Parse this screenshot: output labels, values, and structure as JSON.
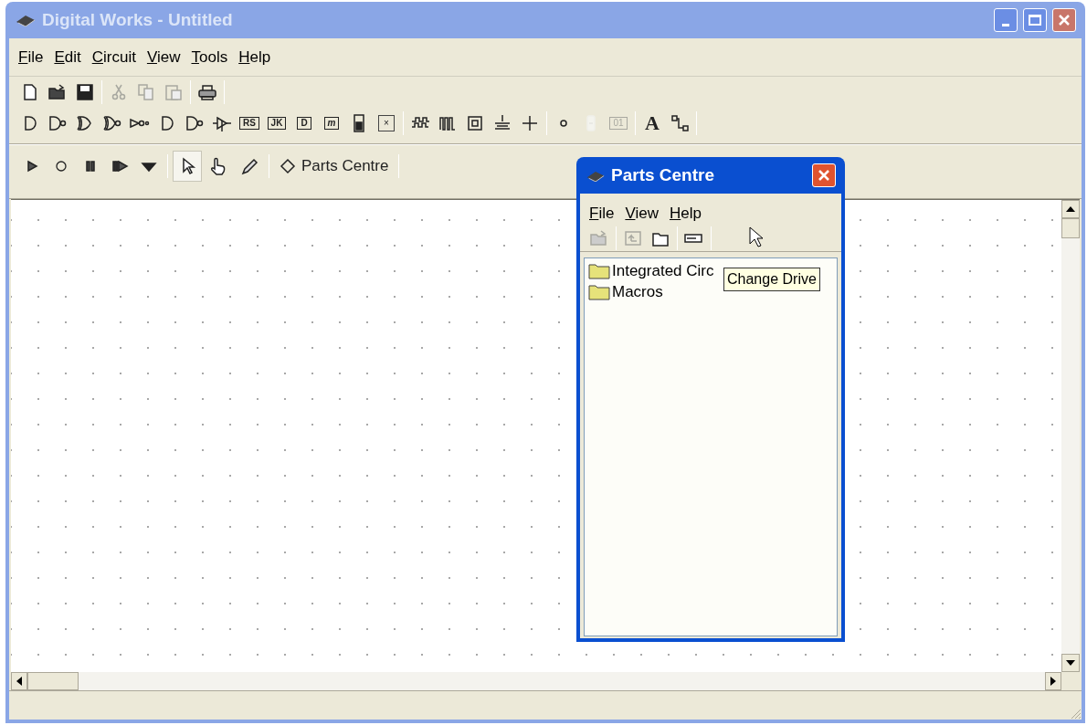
{
  "window": {
    "title": "Digital Works - Untitled",
    "active": false
  },
  "menu": [
    {
      "label": "File"
    },
    {
      "label": "Edit"
    },
    {
      "label": "Circuit"
    },
    {
      "label": "View"
    },
    {
      "label": "Tools"
    },
    {
      "label": "Help"
    }
  ],
  "toolbar_rows": [
    [
      [
        {
          "kind": "new",
          "disabled": false
        },
        {
          "kind": "open",
          "disabled": false
        },
        {
          "kind": "save",
          "disabled": false
        }
      ],
      [
        {
          "kind": "cut",
          "disabled": true
        },
        {
          "kind": "copy",
          "disabled": true
        },
        {
          "kind": "paste",
          "disabled": true
        }
      ],
      [
        {
          "kind": "print",
          "disabled": false
        }
      ]
    ],
    [
      [
        {
          "kind": "and",
          "disabled": false
        },
        {
          "kind": "nand",
          "disabled": false
        },
        {
          "kind": "or",
          "disabled": false
        },
        {
          "kind": "nor",
          "disabled": false
        },
        {
          "kind": "not",
          "disabled": false
        },
        {
          "kind": "and",
          "disabled": false
        },
        {
          "kind": "nand",
          "disabled": false
        },
        {
          "kind": "tristate",
          "disabled": false
        },
        {
          "kind": "chip",
          "label": "RS",
          "disabled": false
        },
        {
          "kind": "chip",
          "label": "JK",
          "disabled": false
        },
        {
          "kind": "chip",
          "label": "D",
          "disabled": false
        },
        {
          "kind": "chip",
          "label": "m",
          "disabled": false
        },
        {
          "kind": "switch",
          "disabled": false
        },
        {
          "kind": "square",
          "label": "×",
          "disabled": false
        }
      ],
      [
        {
          "kind": "clock",
          "disabled": false
        },
        {
          "kind": "pulse",
          "disabled": false
        },
        {
          "kind": "push",
          "disabled": false
        },
        {
          "kind": "ground",
          "disabled": false
        },
        {
          "kind": "plus",
          "disabled": false
        }
      ],
      [
        {
          "kind": "dot",
          "disabled": false
        },
        {
          "kind": "segment",
          "disabled": true
        },
        {
          "kind": "chip",
          "label": "01",
          "disabled": true
        }
      ],
      [
        {
          "kind": "letter",
          "label": "A",
          "disabled": false
        },
        {
          "kind": "wire",
          "disabled": false
        }
      ]
    ]
  ],
  "control_bar": {
    "run": [
      {
        "kind": "play"
      },
      {
        "kind": "stop"
      },
      {
        "kind": "pause"
      },
      {
        "kind": "step"
      },
      {
        "kind": "dropdown"
      }
    ],
    "tools": [
      {
        "kind": "pointer",
        "selected": true
      },
      {
        "kind": "hand",
        "selected": false
      },
      {
        "kind": "pen",
        "selected": false
      }
    ],
    "parts_button": {
      "label": "Parts Centre"
    }
  },
  "parts_centre": {
    "title": "Parts Centre",
    "active": true,
    "menu": [
      {
        "label": "File"
      },
      {
        "label": "View"
      },
      {
        "label": "Help"
      }
    ],
    "toolbar": [
      {
        "kind": "open",
        "disabled": true
      },
      {
        "kind": "up",
        "disabled": true
      },
      {
        "kind": "folder",
        "disabled": false
      },
      {
        "kind": "drive",
        "disabled": false
      }
    ],
    "items": [
      {
        "label": "Integrated Circ"
      },
      {
        "label": "Macros"
      }
    ],
    "tooltip": "Change Drive"
  }
}
